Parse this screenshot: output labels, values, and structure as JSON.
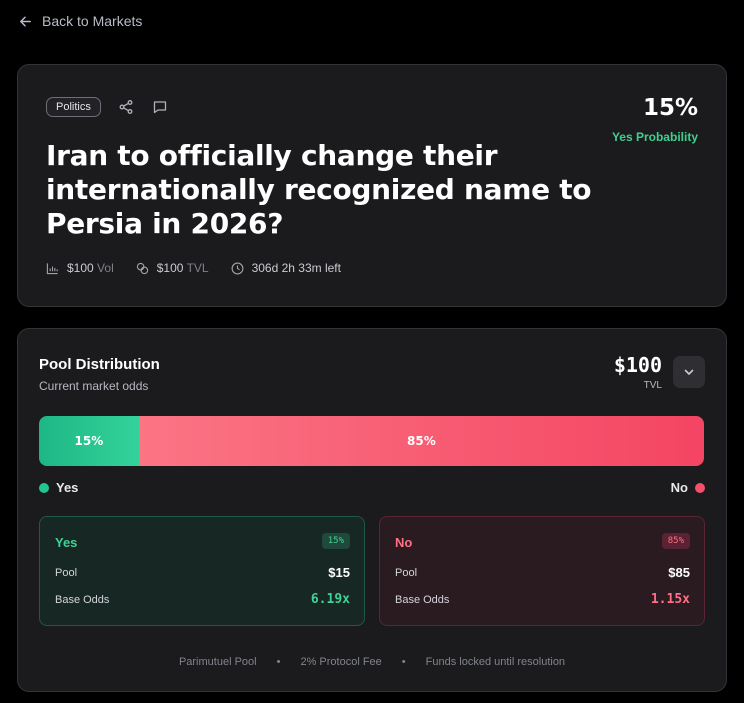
{
  "nav": {
    "back_label": "Back to Markets"
  },
  "market": {
    "tag": "Politics",
    "title": "Iran to officially change their internationally recognized name to Persia in 2026?",
    "probability": "15%",
    "probability_label": "Yes Probability",
    "vol_value": "$100",
    "vol_label": "Vol",
    "tvl_value": "$100",
    "tvl_label": "TVL",
    "time_left": "306d 2h 33m left"
  },
  "pool": {
    "title": "Pool Distribution",
    "subtitle": "Current market odds",
    "tvl_value": "$100",
    "tvl_label": "TVL",
    "yes_fraction": 0.15,
    "yes_pct": "15%",
    "no_pct": "85%",
    "legend_yes": "Yes",
    "legend_no": "No",
    "yes_side": {
      "label": "Yes",
      "badge": "15%",
      "pool_label": "Pool",
      "pool_value": "$15",
      "odds_label": "Base Odds",
      "odds_value": "6.19x"
    },
    "no_side": {
      "label": "No",
      "badge": "85%",
      "pool_label": "Pool",
      "pool_value": "$85",
      "odds_label": "Base Odds",
      "odds_value": "1.15x"
    },
    "footer": [
      "Parimutuel Pool",
      "•",
      "2% Protocol Fee",
      "•",
      "Funds locked until resolution"
    ]
  },
  "colors": {
    "yes": "#22c58d",
    "no": "#f4506b",
    "accent_green_text": "#3fd08f",
    "no_text": "#ff6f86"
  },
  "icons": {
    "back": "arrow-left-icon",
    "share": "share-icon",
    "comment": "comment-icon",
    "volume": "bar-chart-icon",
    "tvl": "coins-icon",
    "time": "clock-icon",
    "expand": "chevron-down-icon"
  }
}
